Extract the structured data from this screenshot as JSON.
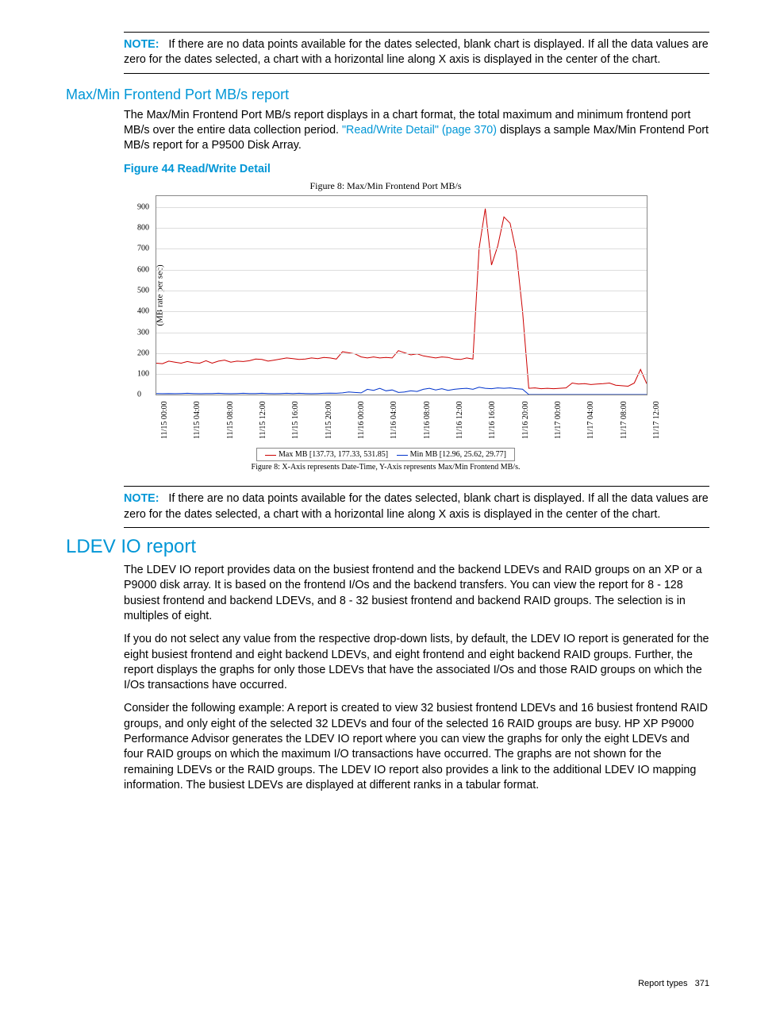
{
  "note1": {
    "label": "NOTE:",
    "text": "If there are no data points available for the dates selected, blank chart is displayed. If all the data values are zero for the dates selected, a chart with a horizontal line along X axis is displayed in the center of the chart."
  },
  "section1": {
    "heading": "Max/Min Frontend Port MB/s report",
    "p1a": "The Max/Min Frontend Port MB/s report displays in a chart format, the total maximum and minimum frontend port MB/s over the entire data collection period. ",
    "p1_link": "\"Read/Write Detail\" (page 370)",
    "p1b": " displays a sample Max/Min Frontend Port MB/s report for a P9500 Disk Array."
  },
  "figure": {
    "caption": "Figure 44 Read/Write Detail",
    "title": "Figure 8: Max/Min Frontend Port MB/s",
    "footnote": "Figure 8: X-Axis represents Date-Time, Y-Axis represents Max/Min Frontend MB/s.",
    "legend_max": "Max MB  [137.73, 177.33, 531.85]",
    "legend_min": "Min MB  [12.96, 25.62, 29.77]"
  },
  "note2": {
    "label": "NOTE:",
    "text": "If there are no data points available for the dates selected, blank chart is displayed. If all the data values are zero for the dates selected, a chart with a horizontal line along X axis is displayed in the center of the chart."
  },
  "section2": {
    "heading": "LDEV IO report",
    "p1": "The LDEV IO report provides data on the busiest frontend and the backend LDEVs and RAID groups on an XP or a P9000 disk array. It is based on the frontend I/Os and the backend transfers. You can view the report for 8 - 128 busiest frontend and backend LDEVs, and 8 - 32 busiest frontend and backend RAID groups. The selection is in multiples of eight.",
    "p2": "If you do not select any value from the respective drop-down lists, by default, the LDEV IO report is generated for the eight busiest frontend and eight backend LDEVs, and eight frontend and eight backend RAID groups. Further, the report displays the graphs for only those LDEVs that have the associated I/Os and those RAID groups on which the I/Os transactions have occurred.",
    "p3": "Consider the following example: A report is created to view 32 busiest frontend LDEVs and 16 busiest frontend RAID groups, and only eight of the selected 32 LDEVs and four of the selected 16 RAID groups are busy. HP XP P9000 Performance Advisor generates the LDEV IO report where you can view the graphs for only the eight LDEVs and four RAID groups on which the maximum I/O transactions have occurred. The graphs are not shown for the remaining LDEVs or the RAID groups. The LDEV IO report also provides a link to the additional LDEV IO mapping information. The busiest LDEVs are displayed at different ranks in a tabular format."
  },
  "footer": {
    "label": "Report types",
    "page": "371"
  },
  "chart_data": {
    "type": "line",
    "title": "Figure 8: Max/Min Frontend Port MB/s",
    "ylabel": "(MB rate per sec)",
    "xlabel": "",
    "ylim": [
      0,
      950
    ],
    "y_ticks": [
      0,
      100,
      200,
      300,
      400,
      500,
      600,
      700,
      800,
      900
    ],
    "categories": [
      "11/15 00:00",
      "11/15 04:00",
      "11/15 08:00",
      "11/15 12:00",
      "11/15 16:00",
      "11/15 20:00",
      "11/16 00:00",
      "11/16 04:00",
      "11/16 08:00",
      "11/16 12:00",
      "11/16 16:00",
      "11/16 20:00",
      "11/17 00:00",
      "11/17 04:00",
      "11/17 08:00",
      "11/17 12:00"
    ],
    "series": [
      {
        "name": "Max MB",
        "color": "#cc0000",
        "stats": [
          137.73,
          177.33,
          531.85
        ],
        "values": [
          150,
          148,
          160,
          155,
          150,
          158,
          152,
          150,
          162,
          150,
          160,
          165,
          155,
          160,
          158,
          162,
          170,
          168,
          160,
          165,
          170,
          175,
          172,
          168,
          170,
          175,
          172,
          178,
          175,
          170,
          205,
          200,
          195,
          180,
          175,
          180,
          175,
          178,
          175,
          210,
          200,
          190,
          195,
          185,
          180,
          175,
          180,
          178,
          170,
          168,
          175,
          170,
          700,
          890,
          620,
          710,
          850,
          820,
          680,
          400,
          30,
          32,
          28,
          30,
          28,
          30,
          32,
          55,
          50,
          52,
          48,
          50,
          52,
          55,
          45,
          42,
          40,
          55,
          120,
          52
        ]
      },
      {
        "name": "Min MB",
        "color": "#0033cc",
        "stats": [
          12.96,
          25.62,
          29.77
        ],
        "values": [
          5,
          4,
          5,
          4,
          5,
          6,
          5,
          4,
          5,
          5,
          6,
          5,
          4,
          5,
          6,
          5,
          5,
          6,
          5,
          4,
          5,
          6,
          5,
          6,
          5,
          4,
          5,
          6,
          7,
          6,
          8,
          12,
          10,
          8,
          25,
          20,
          30,
          18,
          22,
          10,
          12,
          18,
          15,
          25,
          30,
          22,
          28,
          20,
          25,
          28,
          30,
          25,
          35,
          30,
          28,
          32,
          30,
          32,
          28,
          26,
          0,
          0,
          0,
          0,
          0,
          0,
          0,
          0,
          0,
          0,
          0,
          0,
          0,
          0,
          0,
          0,
          0,
          0,
          0,
          0
        ]
      }
    ]
  }
}
